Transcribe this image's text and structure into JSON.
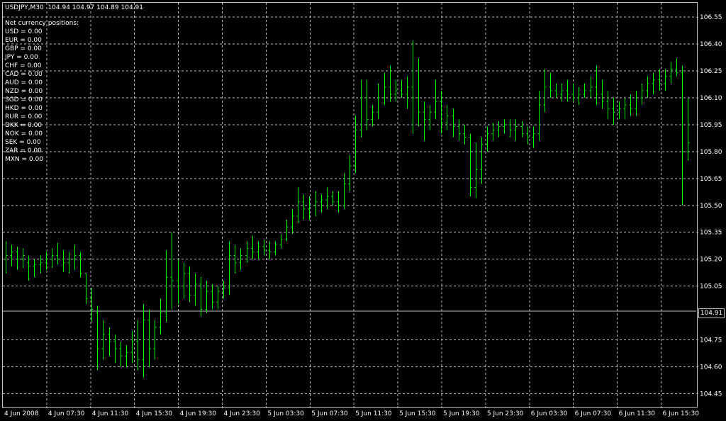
{
  "window": {
    "symbol": "USDJPY,M30",
    "ohlc": "104.94 104.97 104.89 104.91",
    "current_price": "104.91"
  },
  "positions": {
    "title": "Net currency positions:",
    "items": [
      {
        "currency": "USD",
        "text": "USD = 0.00"
      },
      {
        "currency": "EUR",
        "text": "EUR = 0.00"
      },
      {
        "currency": "GBP",
        "text": "GBP = 0.00"
      },
      {
        "currency": "JPY",
        "text": "JPY = 0.00"
      },
      {
        "currency": "CHF",
        "text": "CHF = 0.00"
      },
      {
        "currency": "CAD",
        "text": "CAD = 0.00"
      },
      {
        "currency": "AUD",
        "text": "AUD = 0.00"
      },
      {
        "currency": "NZD",
        "text": "NZD = 0.00"
      },
      {
        "currency": "SGD",
        "text": "SGD = 0.00"
      },
      {
        "currency": "HKD",
        "text": "HKD = 0.00"
      },
      {
        "currency": "RUR",
        "text": "RUR = 0.00"
      },
      {
        "currency": "DKK",
        "text": "DKK = 0.00"
      },
      {
        "currency": "NOK",
        "text": "NOK = 0.00"
      },
      {
        "currency": "SEK",
        "text": "SEK = 0.00"
      },
      {
        "currency": "ZAR",
        "text": "ZAR = 0.00"
      },
      {
        "currency": "MXN",
        "text": "MXN = 0.00"
      }
    ]
  },
  "colors": {
    "background": "#000000",
    "grid": "#c0c0c0",
    "bars": "#00ff00",
    "text": "#ffffff",
    "bid_line": "#c0c0c0"
  },
  "chart_data": {
    "type": "ohlc-bar",
    "timeframe": "M30",
    "ylim": [
      104.38,
      106.63
    ],
    "y_ticks": [
      "106.55",
      "106.40",
      "106.25",
      "106.10",
      "105.95",
      "105.80",
      "105.65",
      "105.50",
      "105.35",
      "105.20",
      "105.05",
      "104.75",
      "104.60",
      "104.45"
    ],
    "x_ticks": [
      "4 Jun 2008",
      "4 Jun 07:30",
      "4 Jun 11:30",
      "4 Jun 15:30",
      "4 Jun 19:30",
      "4 Jun 23:30",
      "5 Jun 03:30",
      "5 Jun 07:30",
      "5 Jun 11:30",
      "5 Jun 15:30",
      "5 Jun 19:30",
      "5 Jun 23:30",
      "6 Jun 03:30",
      "6 Jun 07:30",
      "6 Jun 11:30",
      "6 Jun 15:30"
    ],
    "bid_line": 104.91,
    "bars": [
      {
        "o": 105.2,
        "h": 105.3,
        "l": 105.12,
        "c": 105.22
      },
      {
        "o": 105.22,
        "h": 105.28,
        "l": 105.16,
        "c": 105.24
      },
      {
        "o": 105.24,
        "h": 105.27,
        "l": 105.14,
        "c": 105.2
      },
      {
        "o": 105.2,
        "h": 105.26,
        "l": 105.15,
        "c": 105.22
      },
      {
        "o": 105.18,
        "h": 105.22,
        "l": 105.08,
        "c": 105.16
      },
      {
        "o": 105.16,
        "h": 105.2,
        "l": 105.1,
        "c": 105.17
      },
      {
        "o": 105.17,
        "h": 105.22,
        "l": 105.12,
        "c": 105.18
      },
      {
        "o": 105.18,
        "h": 105.24,
        "l": 105.14,
        "c": 105.2
      },
      {
        "o": 105.2,
        "h": 105.26,
        "l": 105.15,
        "c": 105.22
      },
      {
        "o": 105.22,
        "h": 105.29,
        "l": 105.17,
        "c": 105.2
      },
      {
        "o": 105.2,
        "h": 105.25,
        "l": 105.13,
        "c": 105.18
      },
      {
        "o": 105.18,
        "h": 105.24,
        "l": 105.12,
        "c": 105.2
      },
      {
        "o": 105.2,
        "h": 105.28,
        "l": 105.14,
        "c": 105.22
      },
      {
        "o": 105.22,
        "h": 105.24,
        "l": 105.1,
        "c": 105.12
      },
      {
        "o": 105.12,
        "h": 105.1,
        "l": 104.95,
        "c": 104.98
      },
      {
        "o": 104.98,
        "h": 105.04,
        "l": 104.85,
        "c": 104.92
      },
      {
        "o": 104.9,
        "h": 104.94,
        "l": 104.58,
        "c": 104.7
      },
      {
        "o": 104.7,
        "h": 104.86,
        "l": 104.64,
        "c": 104.78
      },
      {
        "o": 104.78,
        "h": 104.82,
        "l": 104.66,
        "c": 104.74
      },
      {
        "o": 104.74,
        "h": 104.78,
        "l": 104.62,
        "c": 104.7
      },
      {
        "o": 104.7,
        "h": 104.74,
        "l": 104.6,
        "c": 104.66
      },
      {
        "o": 104.66,
        "h": 104.72,
        "l": 104.6,
        "c": 104.68
      },
      {
        "o": 104.68,
        "h": 104.8,
        "l": 104.62,
        "c": 104.74
      },
      {
        "o": 104.74,
        "h": 104.86,
        "l": 104.58,
        "c": 104.64
      },
      {
        "o": 104.64,
        "h": 104.95,
        "l": 104.54,
        "c": 104.86
      },
      {
        "o": 104.86,
        "h": 104.92,
        "l": 104.6,
        "c": 104.7
      },
      {
        "o": 104.7,
        "h": 104.86,
        "l": 104.64,
        "c": 104.82
      },
      {
        "o": 104.82,
        "h": 104.98,
        "l": 104.78,
        "c": 104.9
      },
      {
        "o": 104.9,
        "h": 105.25,
        "l": 104.85,
        "c": 105.1
      },
      {
        "o": 105.1,
        "h": 105.35,
        "l": 104.92,
        "c": 105.08
      },
      {
        "o": 105.08,
        "h": 105.2,
        "l": 104.95,
        "c": 105.05
      },
      {
        "o": 105.05,
        "h": 105.18,
        "l": 104.98,
        "c": 105.12
      },
      {
        "o": 105.12,
        "h": 105.16,
        "l": 104.96,
        "c": 105.0
      },
      {
        "o": 105.0,
        "h": 105.12,
        "l": 104.94,
        "c": 105.06
      },
      {
        "o": 105.06,
        "h": 105.1,
        "l": 104.88,
        "c": 104.92
      },
      {
        "o": 104.92,
        "h": 105.08,
        "l": 104.9,
        "c": 105.02
      },
      {
        "o": 105.02,
        "h": 105.06,
        "l": 104.92,
        "c": 104.96
      },
      {
        "o": 104.96,
        "h": 105.05,
        "l": 104.92,
        "c": 105.02
      },
      {
        "o": 105.02,
        "h": 105.08,
        "l": 104.98,
        "c": 105.04
      },
      {
        "o": 105.04,
        "h": 105.3,
        "l": 105.0,
        "c": 105.22
      },
      {
        "o": 105.22,
        "h": 105.28,
        "l": 105.12,
        "c": 105.18
      },
      {
        "o": 105.18,
        "h": 105.26,
        "l": 105.14,
        "c": 105.22
      },
      {
        "o": 105.22,
        "h": 105.3,
        "l": 105.18,
        "c": 105.26
      },
      {
        "o": 105.26,
        "h": 105.33,
        "l": 105.2,
        "c": 105.24
      },
      {
        "o": 105.24,
        "h": 105.3,
        "l": 105.2,
        "c": 105.27
      },
      {
        "o": 105.27,
        "h": 105.31,
        "l": 105.22,
        "c": 105.25
      },
      {
        "o": 105.25,
        "h": 105.3,
        "l": 105.2,
        "c": 105.24
      },
      {
        "o": 105.24,
        "h": 105.3,
        "l": 105.22,
        "c": 105.28
      },
      {
        "o": 105.28,
        "h": 105.34,
        "l": 105.26,
        "c": 105.31
      },
      {
        "o": 105.31,
        "h": 105.42,
        "l": 105.3,
        "c": 105.38
      },
      {
        "o": 105.38,
        "h": 105.48,
        "l": 105.34,
        "c": 105.44
      },
      {
        "o": 105.44,
        "h": 105.6,
        "l": 105.4,
        "c": 105.52
      },
      {
        "o": 105.52,
        "h": 105.56,
        "l": 105.42,
        "c": 105.48
      },
      {
        "o": 105.48,
        "h": 105.55,
        "l": 105.42,
        "c": 105.5
      },
      {
        "o": 105.5,
        "h": 105.58,
        "l": 105.44,
        "c": 105.52
      },
      {
        "o": 105.52,
        "h": 105.56,
        "l": 105.46,
        "c": 105.53
      },
      {
        "o": 105.53,
        "h": 105.6,
        "l": 105.48,
        "c": 105.55
      },
      {
        "o": 105.55,
        "h": 105.58,
        "l": 105.5,
        "c": 105.52
      },
      {
        "o": 105.52,
        "h": 105.58,
        "l": 105.46,
        "c": 105.5
      },
      {
        "o": 105.5,
        "h": 105.68,
        "l": 105.48,
        "c": 105.62
      },
      {
        "o": 105.62,
        "h": 105.78,
        "l": 105.58,
        "c": 105.72
      },
      {
        "o": 105.72,
        "h": 106.0,
        "l": 105.68,
        "c": 105.92
      },
      {
        "o": 105.92,
        "h": 106.2,
        "l": 105.88,
        "c": 106.1
      },
      {
        "o": 106.1,
        "h": 106.2,
        "l": 105.92,
        "c": 105.98
      },
      {
        "o": 105.98,
        "h": 106.06,
        "l": 105.94,
        "c": 106.02
      },
      {
        "o": 106.02,
        "h": 106.18,
        "l": 105.98,
        "c": 106.1
      },
      {
        "o": 106.1,
        "h": 106.24,
        "l": 106.06,
        "c": 106.16
      },
      {
        "o": 106.16,
        "h": 106.28,
        "l": 106.08,
        "c": 106.12
      },
      {
        "o": 106.12,
        "h": 106.2,
        "l": 106.08,
        "c": 106.14
      },
      {
        "o": 106.14,
        "h": 106.2,
        "l": 106.1,
        "c": 106.12
      },
      {
        "o": 106.12,
        "h": 106.22,
        "l": 106.04,
        "c": 106.16
      },
      {
        "o": 106.16,
        "h": 106.42,
        "l": 105.9,
        "c": 106.1
      },
      {
        "o": 106.1,
        "h": 106.32,
        "l": 105.94,
        "c": 106.02
      },
      {
        "o": 106.02,
        "h": 106.08,
        "l": 105.86,
        "c": 105.98
      },
      {
        "o": 105.98,
        "h": 106.06,
        "l": 105.92,
        "c": 106.02
      },
      {
        "o": 106.02,
        "h": 106.2,
        "l": 105.98,
        "c": 106.08
      },
      {
        "o": 106.08,
        "h": 106.14,
        "l": 105.9,
        "c": 105.96
      },
      {
        "o": 105.96,
        "h": 106.06,
        "l": 105.92,
        "c": 106.0
      },
      {
        "o": 106.0,
        "h": 106.04,
        "l": 105.88,
        "c": 105.94
      },
      {
        "o": 105.94,
        "h": 105.98,
        "l": 105.86,
        "c": 105.9
      },
      {
        "o": 105.9,
        "h": 105.95,
        "l": 105.84,
        "c": 105.88
      },
      {
        "o": 105.88,
        "h": 105.9,
        "l": 105.55,
        "c": 105.6
      },
      {
        "o": 105.6,
        "h": 105.85,
        "l": 105.54,
        "c": 105.7
      },
      {
        "o": 105.7,
        "h": 105.88,
        "l": 105.62,
        "c": 105.84
      },
      {
        "o": 105.84,
        "h": 105.94,
        "l": 105.8,
        "c": 105.9
      },
      {
        "o": 105.9,
        "h": 105.96,
        "l": 105.86,
        "c": 105.92
      },
      {
        "o": 105.92,
        "h": 105.97,
        "l": 105.88,
        "c": 105.94
      },
      {
        "o": 105.94,
        "h": 105.98,
        "l": 105.9,
        "c": 105.95
      },
      {
        "o": 105.95,
        "h": 105.98,
        "l": 105.88,
        "c": 105.92
      },
      {
        "o": 105.92,
        "h": 105.98,
        "l": 105.86,
        "c": 105.94
      },
      {
        "o": 105.94,
        "h": 105.97,
        "l": 105.88,
        "c": 105.9
      },
      {
        "o": 105.9,
        "h": 105.94,
        "l": 105.84,
        "c": 105.88
      },
      {
        "o": 105.88,
        "h": 105.94,
        "l": 105.82,
        "c": 105.9
      },
      {
        "o": 105.9,
        "h": 106.14,
        "l": 105.86,
        "c": 106.06
      },
      {
        "o": 106.06,
        "h": 106.26,
        "l": 106.02,
        "c": 106.16
      },
      {
        "o": 106.16,
        "h": 106.24,
        "l": 106.1,
        "c": 106.14
      },
      {
        "o": 106.14,
        "h": 106.18,
        "l": 106.1,
        "c": 106.12
      },
      {
        "o": 106.12,
        "h": 106.18,
        "l": 106.08,
        "c": 106.14
      },
      {
        "o": 106.14,
        "h": 106.2,
        "l": 106.08,
        "c": 106.12
      },
      {
        "o": 106.12,
        "h": 106.18,
        "l": 106.08,
        "c": 106.1
      },
      {
        "o": 106.1,
        "h": 106.16,
        "l": 106.06,
        "c": 106.12
      },
      {
        "o": 106.12,
        "h": 106.18,
        "l": 106.1,
        "c": 106.14
      },
      {
        "o": 106.14,
        "h": 106.22,
        "l": 106.1,
        "c": 106.16
      },
      {
        "o": 106.16,
        "h": 106.28,
        "l": 106.06,
        "c": 106.12
      },
      {
        "o": 106.12,
        "h": 106.2,
        "l": 106.04,
        "c": 106.08
      },
      {
        "o": 106.08,
        "h": 106.14,
        "l": 105.98,
        "c": 106.04
      },
      {
        "o": 106.04,
        "h": 106.1,
        "l": 105.95,
        "c": 106.02
      },
      {
        "o": 106.02,
        "h": 106.08,
        "l": 105.98,
        "c": 106.04
      },
      {
        "o": 106.04,
        "h": 106.1,
        "l": 105.98,
        "c": 106.06
      },
      {
        "o": 106.06,
        "h": 106.12,
        "l": 106.0,
        "c": 106.04
      },
      {
        "o": 106.04,
        "h": 106.14,
        "l": 106.0,
        "c": 106.1
      },
      {
        "o": 106.1,
        "h": 106.18,
        "l": 106.06,
        "c": 106.14
      },
      {
        "o": 106.14,
        "h": 106.22,
        "l": 106.1,
        "c": 106.18
      },
      {
        "o": 106.18,
        "h": 106.24,
        "l": 106.12,
        "c": 106.2
      },
      {
        "o": 106.2,
        "h": 106.26,
        "l": 106.14,
        "c": 106.18
      },
      {
        "o": 106.18,
        "h": 106.26,
        "l": 106.14,
        "c": 106.22
      },
      {
        "o": 106.22,
        "h": 106.3,
        "l": 106.18,
        "c": 106.26
      },
      {
        "o": 106.26,
        "h": 106.32,
        "l": 106.22,
        "c": 106.24
      },
      {
        "o": 106.24,
        "h": 106.28,
        "l": 105.5,
        "c": 105.8
      },
      {
        "o": 105.8,
        "h": 106.1,
        "l": 105.75,
        "c": 105.85
      }
    ]
  }
}
